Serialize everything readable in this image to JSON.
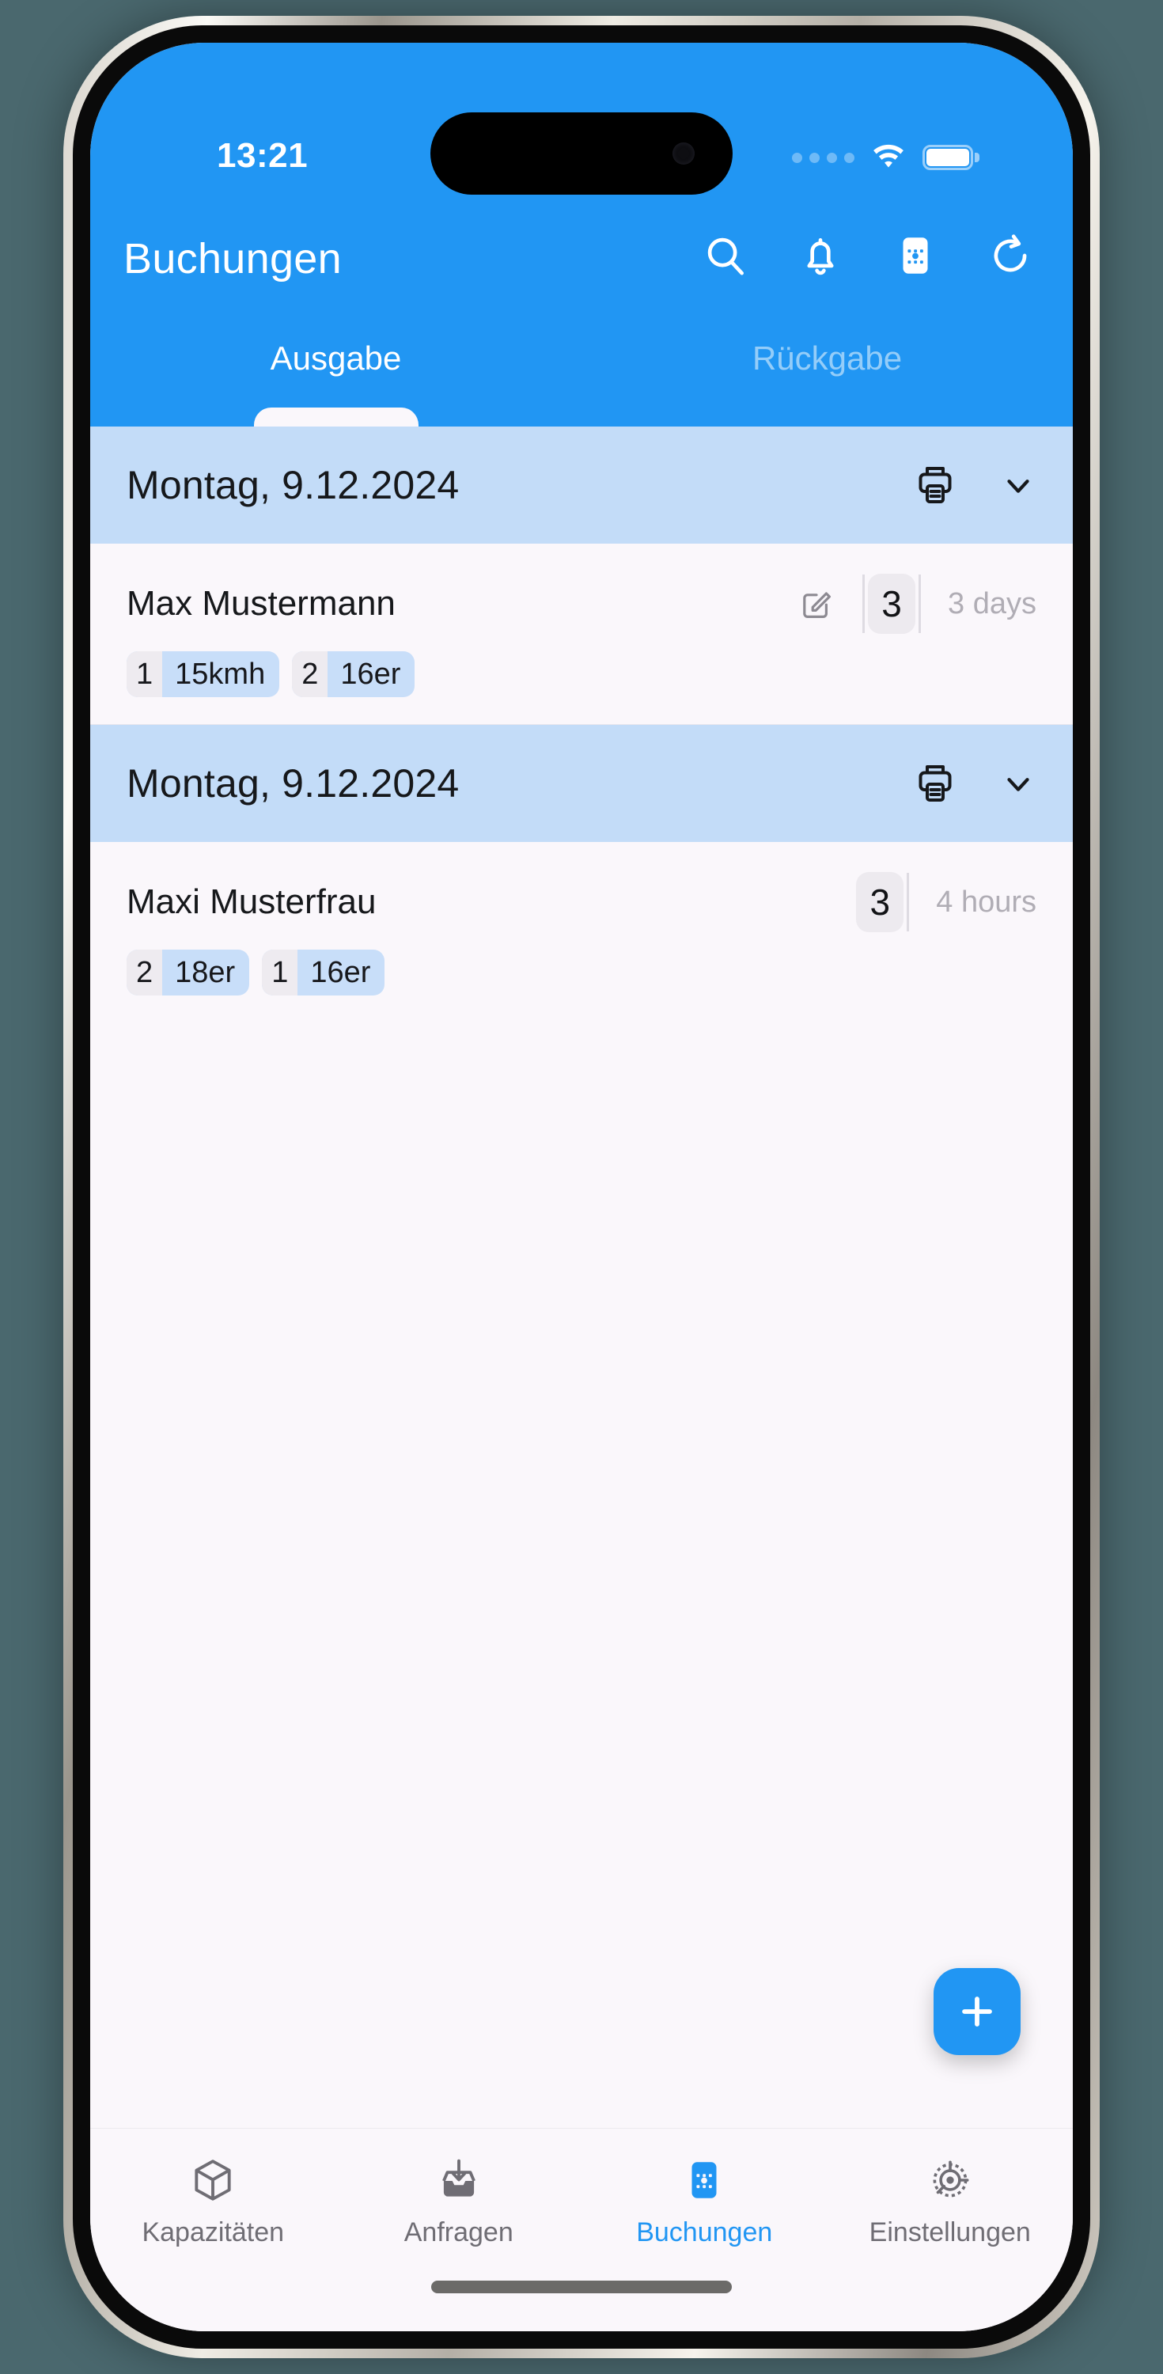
{
  "status_bar": {
    "time": "13:21",
    "signal_icon": "cellular-dots-icon",
    "wifi_icon": "wifi-icon",
    "battery_icon": "battery-icon"
  },
  "app_bar": {
    "title": "Buchungen",
    "actions": [
      {
        "name": "search-icon",
        "label": "Suche"
      },
      {
        "name": "bell-icon",
        "label": "Benachrichtigungen"
      },
      {
        "name": "calendar-icon",
        "label": "Kalender"
      },
      {
        "name": "refresh-icon",
        "label": "Aktualisieren"
      }
    ]
  },
  "tabs": [
    {
      "label": "Ausgabe",
      "active": true
    },
    {
      "label": "Rückgabe",
      "active": false
    }
  ],
  "groups": [
    {
      "date": "Montag, 9.12.2024",
      "print_icon": "printer-icon",
      "collapse_icon": "chevron-down-icon",
      "bookings": [
        {
          "name": "Max Mustermann",
          "has_edit": true,
          "edit_icon": "edit-pencil-icon",
          "count": "3",
          "duration": "3 days",
          "tags": [
            {
              "count": "1",
              "label": "15kmh"
            },
            {
              "count": "2",
              "label": "16er"
            }
          ]
        }
      ]
    },
    {
      "date": "Montag, 9.12.2024",
      "print_icon": "printer-icon",
      "collapse_icon": "chevron-down-icon",
      "bookings": [
        {
          "name": "Maxi Musterfrau",
          "has_edit": false,
          "edit_icon": "",
          "count": "3",
          "duration": "4 hours",
          "tags": [
            {
              "count": "2",
              "label": "18er"
            },
            {
              "count": "1",
              "label": "16er"
            }
          ]
        }
      ]
    }
  ],
  "fab": {
    "icon": "plus-icon",
    "label": "Neue Buchung"
  },
  "bottom_nav": [
    {
      "label": "Kapazitäten",
      "icon": "cube-icon",
      "active": false
    },
    {
      "label": "Anfragen",
      "icon": "inbox-download-icon",
      "active": false
    },
    {
      "label": "Buchungen",
      "icon": "calendar-icon",
      "active": true
    },
    {
      "label": "Einstellungen",
      "icon": "gear-icon",
      "active": false
    }
  ],
  "colors": {
    "accent": "#2196f3",
    "date_header_bg": "#c3dcf8",
    "tag_bg": "#c8def9",
    "chip_bg": "#edeaef",
    "surface": "#faf7fb",
    "muted_text": "#b0adb5",
    "device_bg": "#4a686e"
  }
}
